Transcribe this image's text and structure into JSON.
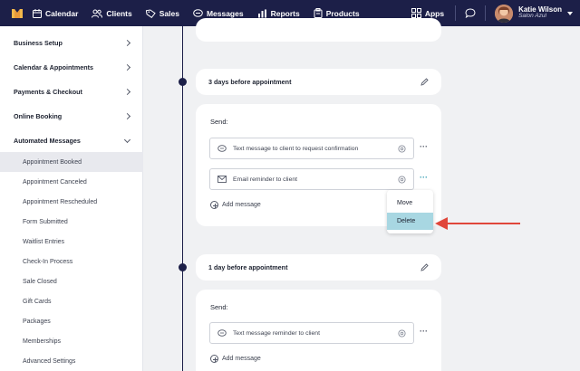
{
  "nav": {
    "items": [
      {
        "label": "Calendar",
        "icon": "calendar-icon"
      },
      {
        "label": "Clients",
        "icon": "clients-icon"
      },
      {
        "label": "Sales",
        "icon": "tag-icon"
      },
      {
        "label": "Messages",
        "icon": "chat-icon"
      },
      {
        "label": "Reports",
        "icon": "bar-chart-icon"
      },
      {
        "label": "Products",
        "icon": "box-icon"
      }
    ],
    "apps_label": "Apps",
    "user_name": "Katie Wilson",
    "user_salon": "Salon Azul"
  },
  "sidebar": {
    "sections": [
      {
        "label": "Business Setup",
        "expanded": false
      },
      {
        "label": "Calendar & Appointments",
        "expanded": false
      },
      {
        "label": "Payments & Checkout",
        "expanded": false
      },
      {
        "label": "Online Booking",
        "expanded": false
      },
      {
        "label": "Automated Messages",
        "expanded": true
      }
    ],
    "subitems": [
      "Appointment Booked",
      "Appointment Canceled",
      "Appointment Rescheduled",
      "Form Submitted",
      "Waitlist Entries",
      "Check-In Process",
      "Sale Closed",
      "Gift Cards",
      "Packages",
      "Memberships",
      "Advanced Settings"
    ],
    "active_subitem": "Appointment Booked"
  },
  "main": {
    "block1": {
      "title": "3 days before appointment",
      "send_label": "Send:",
      "messages": [
        "Text message to client to request confirmation",
        "Email reminder to client"
      ],
      "add_message_label": "Add message"
    },
    "block2": {
      "title": "1 day before appointment",
      "send_label": "Send:",
      "messages": [
        "Text message reminder to client"
      ],
      "add_message_label": "Add message"
    },
    "context_menu": {
      "items": [
        "Move",
        "Delete"
      ],
      "highlighted": "Delete"
    }
  },
  "colors": {
    "nav_bg": "#1c1f48",
    "highlight": "#a8d7e2",
    "arrow": "#e0463a"
  }
}
